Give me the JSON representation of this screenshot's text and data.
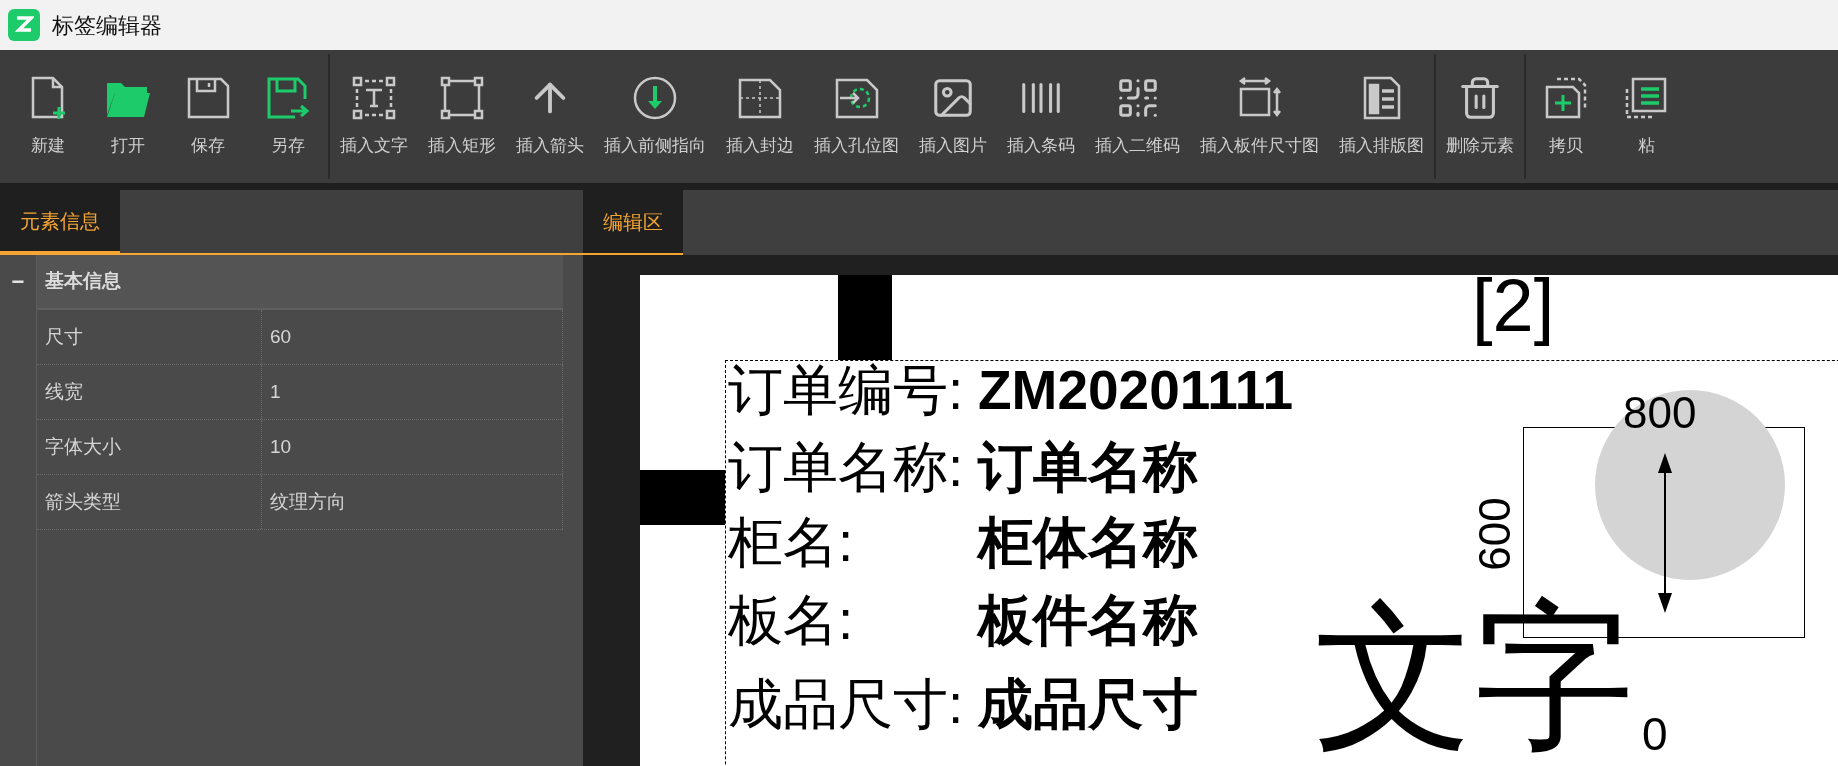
{
  "window": {
    "title": "标签编辑器"
  },
  "toolbar": {
    "groups": [
      {
        "items": [
          {
            "label": "新建",
            "kind": "new"
          },
          {
            "label": "打开",
            "kind": "open"
          },
          {
            "label": "保存",
            "kind": "save"
          },
          {
            "label": "另存",
            "kind": "saveas"
          }
        ]
      },
      {
        "items": [
          {
            "label": "插入文字",
            "kind": "text"
          },
          {
            "label": "插入矩形",
            "kind": "rect"
          },
          {
            "label": "插入箭头",
            "kind": "arrow"
          },
          {
            "label": "插入前侧指向",
            "kind": "front"
          },
          {
            "label": "插入封边",
            "kind": "edge"
          },
          {
            "label": "插入孔位图",
            "kind": "hole"
          },
          {
            "label": "插入图片",
            "kind": "image"
          },
          {
            "label": "插入条码",
            "kind": "barcode"
          },
          {
            "label": "插入二维码",
            "kind": "qr"
          },
          {
            "label": "插入板件尺寸图",
            "kind": "size"
          },
          {
            "label": "插入排版图",
            "kind": "layout"
          }
        ]
      },
      {
        "items": [
          {
            "label": "删除元素",
            "kind": "delete"
          }
        ]
      },
      {
        "items": [
          {
            "label": "拷贝",
            "kind": "copy"
          },
          {
            "label": "粘",
            "kind": "paste"
          }
        ]
      }
    ]
  },
  "left_panel": {
    "tabs": [
      {
        "label": "元素信息",
        "selected": true
      }
    ],
    "group": {
      "title": "基本信息",
      "expanded": true,
      "toggle": "−",
      "rows": [
        {
          "name": "尺寸",
          "value": "60"
        },
        {
          "name": "线宽",
          "value": "1"
        },
        {
          "name": "字体大小",
          "value": "10"
        },
        {
          "name": "箭头类型",
          "value": "纹理方向"
        }
      ]
    }
  },
  "editor": {
    "tabs": [
      {
        "label": "编辑区",
        "selected": true
      }
    ],
    "label": {
      "marker": "[2]",
      "fields": [
        {
          "label": "订单编号:",
          "value": "ZM20201111"
        },
        {
          "label": "订单名称:",
          "value": "订单名称"
        },
        {
          "label": "柜名:",
          "value": "柜体名称"
        },
        {
          "label": "板名:",
          "value": "板件名称"
        },
        {
          "label": "成品尺寸:",
          "value": "成品尺寸"
        }
      ],
      "width_label": "800",
      "height_label": "600",
      "big_text": "文字",
      "corner_value": "0"
    }
  }
}
